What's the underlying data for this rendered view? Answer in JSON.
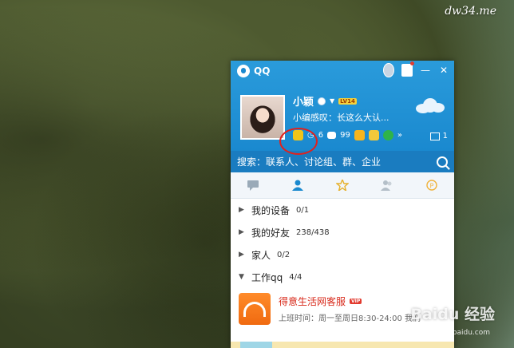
{
  "watermark": "dw34.me",
  "window": {
    "title": "QQ"
  },
  "profile": {
    "name": "小颖",
    "level": "LV14",
    "signature": "小编感叹：长这么大认...",
    "counts": {
      "messages": "6",
      "mail": "99",
      "tray": "1"
    }
  },
  "search": {
    "placeholder": "搜索：联系人、讨论组、群、企业"
  },
  "groups": [
    {
      "name": "我的设备",
      "count": "0/1",
      "expanded": false
    },
    {
      "name": "我的好友",
      "count": "238/438",
      "expanded": false
    },
    {
      "name": "家人",
      "count": "0/2",
      "expanded": false
    },
    {
      "name": "工作qq",
      "count": "4/4",
      "expanded": true
    }
  ],
  "contact": {
    "name": "得意生活网客服",
    "badge": "VIP",
    "status": "上班时间：周一至周日8:30-24:00  我们"
  },
  "overlay": {
    "brand": "Baidu 经验",
    "url": "jingyan.baidu.com"
  },
  "colors": {
    "accent": "#1a89cf",
    "annotation": "#e0211d"
  }
}
